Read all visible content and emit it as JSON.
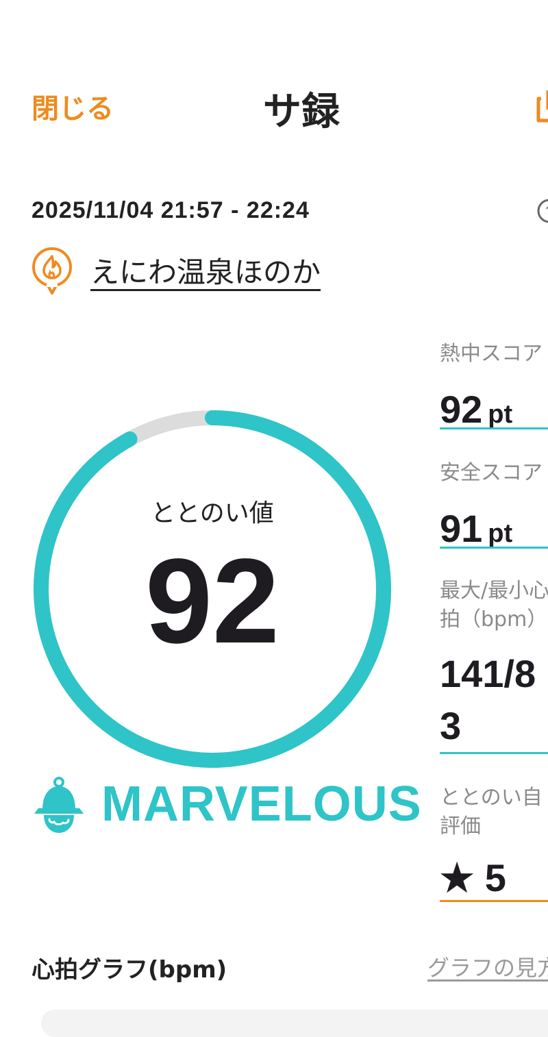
{
  "header": {
    "close_label": "閉じる",
    "title": "サ録",
    "share_icon": "share-icon"
  },
  "session": {
    "datetime": "2025/11/04 21:57 - 22:24",
    "place": "えにわ温泉ほのか",
    "place_icon": "sauna-fire-pin-icon",
    "help_icon": "help-icon"
  },
  "totonoi": {
    "label": "ととのい値",
    "value": "92",
    "ring_progress": 0.92,
    "rank": "MARVELOUS",
    "rank_icon": "sauna-hat-icon"
  },
  "stats": [
    {
      "label": "熱中スコア",
      "value": "92",
      "unit": "pt"
    },
    {
      "label": "安全スコア",
      "value": "91",
      "unit": "pt"
    },
    {
      "label": "最大/最小心\n拍（bpm）",
      "value": "141/8\n3",
      "unit": ""
    },
    {
      "label": "ととのい自\n評価",
      "value": "★ 5",
      "unit": ""
    }
  ],
  "graph": {
    "title": "心拍グラフ(bpm)",
    "link": "グラフの見方"
  },
  "colors": {
    "accent_orange": "#f08a1e",
    "accent_teal": "#2ec4c8",
    "ring_track": "#dcdcdc",
    "text_dark": "#1e1b21",
    "text_muted": "#8a8a8a"
  }
}
